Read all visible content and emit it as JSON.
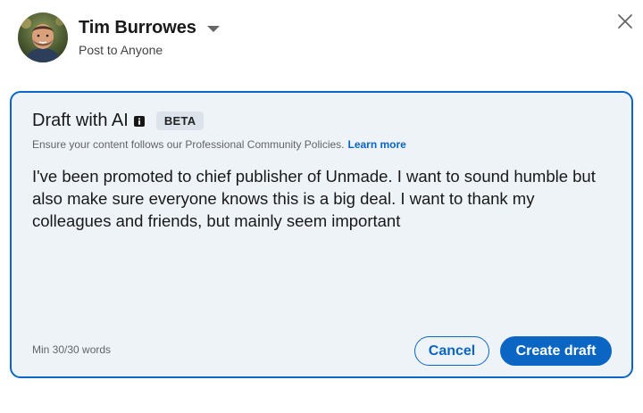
{
  "header": {
    "user_name": "Tim Burrowes",
    "audience": "Post to Anyone"
  },
  "draft": {
    "title": "Draft with AI",
    "badge": "BETA",
    "policy_text": "Ensure your content follows our Professional Community Policies.",
    "learn_more": "Learn more",
    "prompt_text": "I've been promoted to chief publisher of Unmade. I want to sound humble but also make sure everyone knows this is a big deal. I want to thank my colleagues and friends, but mainly seem important",
    "word_count": "Min 30/30 words",
    "cancel_label": "Cancel",
    "create_label": "Create draft"
  },
  "colors": {
    "accent": "#0a66c2",
    "card_background": "#eef3f8",
    "badge_background": "#dce3ea"
  },
  "icons": {
    "close": "close-icon",
    "dropdown": "caret-down-icon",
    "info": "info-icon"
  }
}
